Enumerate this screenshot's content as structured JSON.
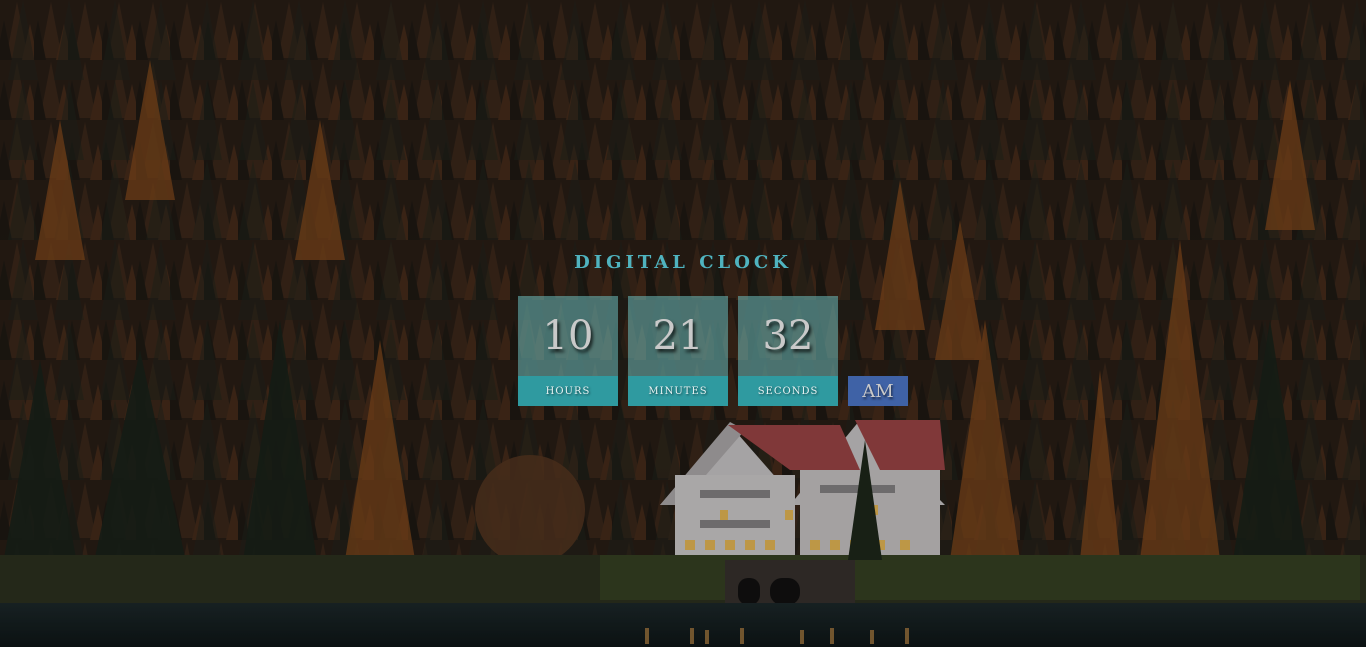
{
  "title": "DIGITAL CLOCK",
  "clock": {
    "hours": "10",
    "minutes": "21",
    "seconds": "32",
    "hours_label": "HOURS",
    "minutes_label": "MINUTES",
    "seconds_label": "SECONDS",
    "period": "AM"
  },
  "colors": {
    "title": "#4fb3bf",
    "label_bg": "#2f9aa0",
    "value_bg": "#6ebebe",
    "period_bg": "#3f62a6"
  },
  "background": {
    "description_icon": "forest-lake-house-photo"
  }
}
